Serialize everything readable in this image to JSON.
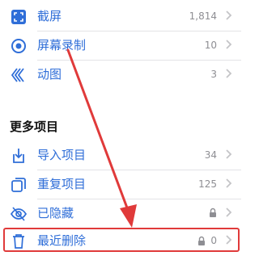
{
  "media_types": [
    {
      "label": "截屏",
      "count": "1,814",
      "icon": "screenshot-icon"
    },
    {
      "label": "屏幕录制",
      "count": "10",
      "icon": "screen-recording-icon"
    },
    {
      "label": "动图",
      "count": "3",
      "icon": "animated-icon"
    }
  ],
  "more_section": {
    "title": "更多项目",
    "items": [
      {
        "label": "导入项目",
        "count": "34",
        "icon": "import-icon"
      },
      {
        "label": "重复项目",
        "count": "125",
        "icon": "duplicates-icon"
      },
      {
        "label": "已隐藏",
        "count": "",
        "icon": "hidden-icon",
        "locked": true
      },
      {
        "label": "最近删除",
        "count": "0",
        "icon": "trash-icon",
        "locked": true
      }
    ]
  },
  "colors": {
    "accent": "#2f6ed8",
    "annotation": "#e03a3a",
    "muted": "#8e8e93"
  }
}
